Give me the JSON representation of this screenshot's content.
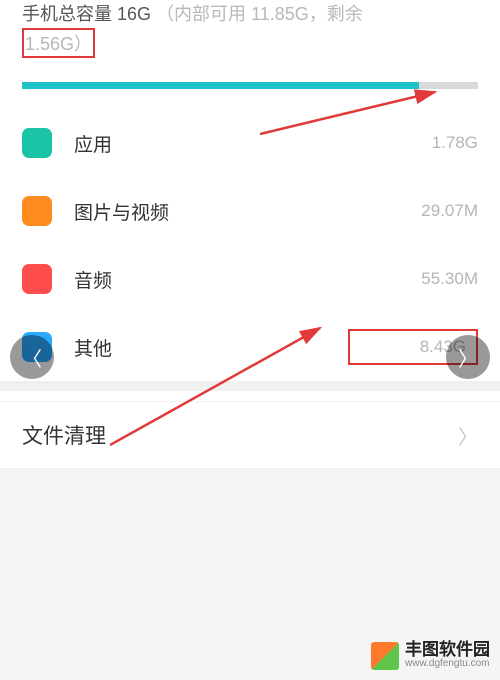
{
  "header": {
    "title_prefix": "手机总容量 ",
    "total_capacity": "16G",
    "subtitle_open": "（内部可用 ",
    "internal_available": "11.85G",
    "subtitle_mid": "，剩余",
    "remaining": "1.56G",
    "subtitle_close": "）"
  },
  "progress_pct": 87,
  "categories": [
    {
      "label": "应用",
      "value": "1.78G",
      "color": "#1cc4a7"
    },
    {
      "label": "图片与视频",
      "value": "29.07M",
      "color": "#ff8a1e"
    },
    {
      "label": "音频",
      "value": "55.30M",
      "color": "#ff4c4c"
    },
    {
      "label": "其他",
      "value": "8.43G",
      "color": "#2aa9ff"
    }
  ],
  "cleanup_label": "文件清理",
  "icons": {
    "chevron_right": "〉",
    "chevron_left": "〈"
  },
  "watermark": {
    "name": "丰图软件园",
    "url": "www.dgfengtu.com"
  }
}
